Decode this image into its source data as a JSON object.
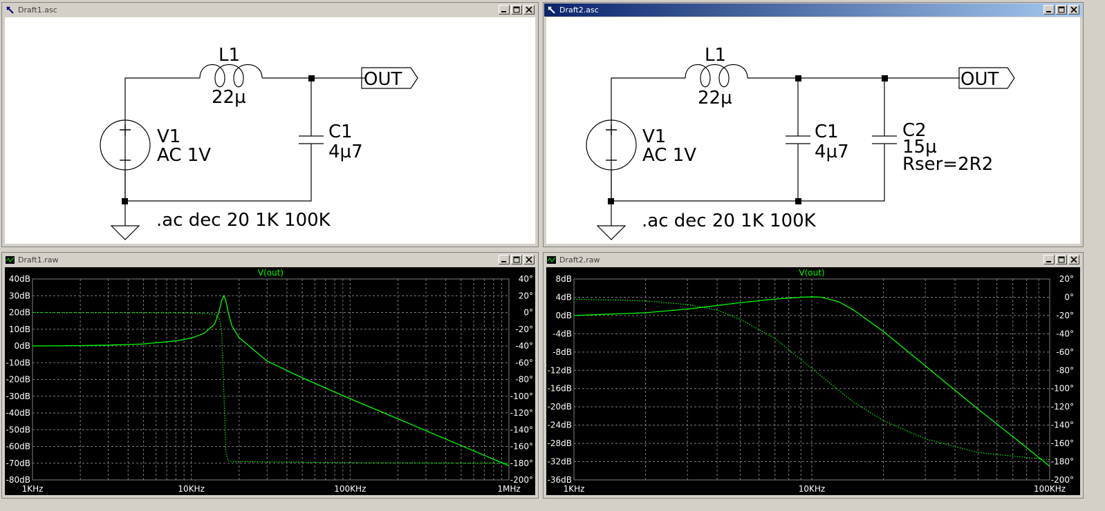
{
  "windows": {
    "draft1_schematic": {
      "title": "Draft1.asc"
    },
    "draft2_schematic": {
      "title": "Draft2.asc"
    },
    "draft1_plot": {
      "title": "Draft1.raw"
    },
    "draft2_plot": {
      "title": "Draft2.raw"
    }
  },
  "schematic1": {
    "l1_name": "L1",
    "l1_value": "22µ",
    "v1_name": "V1",
    "v1_value": "AC 1V",
    "c1_name": "C1",
    "c1_value": "4µ7",
    "out_label": "OUT",
    "directive": ".ac dec 20 1K 100K"
  },
  "schematic2": {
    "l1_name": "L1",
    "l1_value": "22µ",
    "v1_name": "V1",
    "v1_value": "AC 1V",
    "c1_name": "C1",
    "c1_value": "4µ7",
    "c2_name": "C2",
    "c2_value": "15µ",
    "c2_rser": "Rser=2R2",
    "out_label": "OUT",
    "directive": ".ac dec 20 1K 100K"
  },
  "colors": {
    "trace": "#00ff00",
    "grid": "#808080",
    "axis_text": "#ffffff",
    "plot_bg": "#000000"
  },
  "chart_data": [
    {
      "type": "line",
      "title": "V(out)",
      "x_scale": "log",
      "xlim": [
        1000,
        1000000
      ],
      "x_ticks": [
        "1KHz",
        "10KHz",
        "100KHz",
        "1MHz"
      ],
      "ylim": [
        -80,
        40
      ],
      "y_ticks": [
        "40dB",
        "30dB",
        "20dB",
        "10dB",
        "0dB",
        "-10dB",
        "-20dB",
        "-30dB",
        "-40dB",
        "-50dB",
        "-60dB",
        "-70dB",
        "-80dB"
      ],
      "y2lim": [
        -200,
        40
      ],
      "y2_ticks": [
        "40°",
        "20°",
        "0°",
        "-20°",
        "-40°",
        "-60°",
        "-80°",
        "-100°",
        "-120°",
        "-140°",
        "-160°",
        "-180°",
        "-200°"
      ],
      "grid": true,
      "series": [
        {
          "style": "solid",
          "axis": "left",
          "x": [
            1000,
            2000,
            3000,
            5000,
            8000,
            10000,
            12000,
            14000,
            15000,
            15500,
            16000,
            16500,
            17000,
            18000,
            20000,
            30000,
            50000,
            100000,
            200000,
            500000,
            1000000
          ],
          "y": [
            0,
            0.2,
            0.5,
            1.2,
            3,
            4.7,
            7.5,
            13,
            21,
            27,
            30,
            27,
            21,
            12,
            5,
            -9,
            -19,
            -31.5,
            -43.5,
            -59.5,
            -71.5
          ]
        },
        {
          "style": "dotted",
          "axis": "right",
          "x": [
            1000,
            10000,
            14000,
            15000,
            15500,
            16000,
            16500,
            17000,
            18000,
            100000,
            1000000
          ],
          "y": [
            0,
            -0.5,
            -2,
            -7,
            -20,
            -90,
            -165,
            -177,
            -178,
            -179.5,
            -180
          ]
        }
      ]
    },
    {
      "type": "line",
      "title": "V(out)",
      "x_scale": "log",
      "xlim": [
        1000,
        100000
      ],
      "x_ticks": [
        "1KHz",
        "10KHz",
        "100KHz"
      ],
      "ylim": [
        -36,
        8
      ],
      "y_ticks": [
        "8dB",
        "4dB",
        "0dB",
        "-4dB",
        "-8dB",
        "-12dB",
        "-16dB",
        "-20dB",
        "-24dB",
        "-28dB",
        "-32dB",
        "-36dB"
      ],
      "y2lim": [
        -200,
        20
      ],
      "y2_ticks": [
        "20°",
        "0°",
        "-20°",
        "-40°",
        "-60°",
        "-80°",
        "-100°",
        "-120°",
        "-140°",
        "-160°",
        "-180°",
        "-200°"
      ],
      "grid": true,
      "series": [
        {
          "style": "solid",
          "axis": "left",
          "x": [
            1000,
            2000,
            3000,
            5000,
            7000,
            9000,
            10000,
            11000,
            13000,
            15000,
            20000,
            30000,
            50000,
            70000,
            100000
          ],
          "y": [
            0,
            0.6,
            1.4,
            2.8,
            3.6,
            4,
            4.1,
            4,
            3,
            1.2,
            -3.5,
            -11,
            -20.5,
            -26.5,
            -33
          ]
        },
        {
          "style": "dotted",
          "axis": "right",
          "x": [
            1000,
            2000,
            3000,
            4000,
            5000,
            7000,
            10000,
            15000,
            20000,
            30000,
            50000,
            100000
          ],
          "y": [
            -2,
            -4,
            -8,
            -14,
            -24,
            -45,
            -78,
            -115,
            -135,
            -155,
            -170,
            -178
          ]
        }
      ]
    }
  ]
}
